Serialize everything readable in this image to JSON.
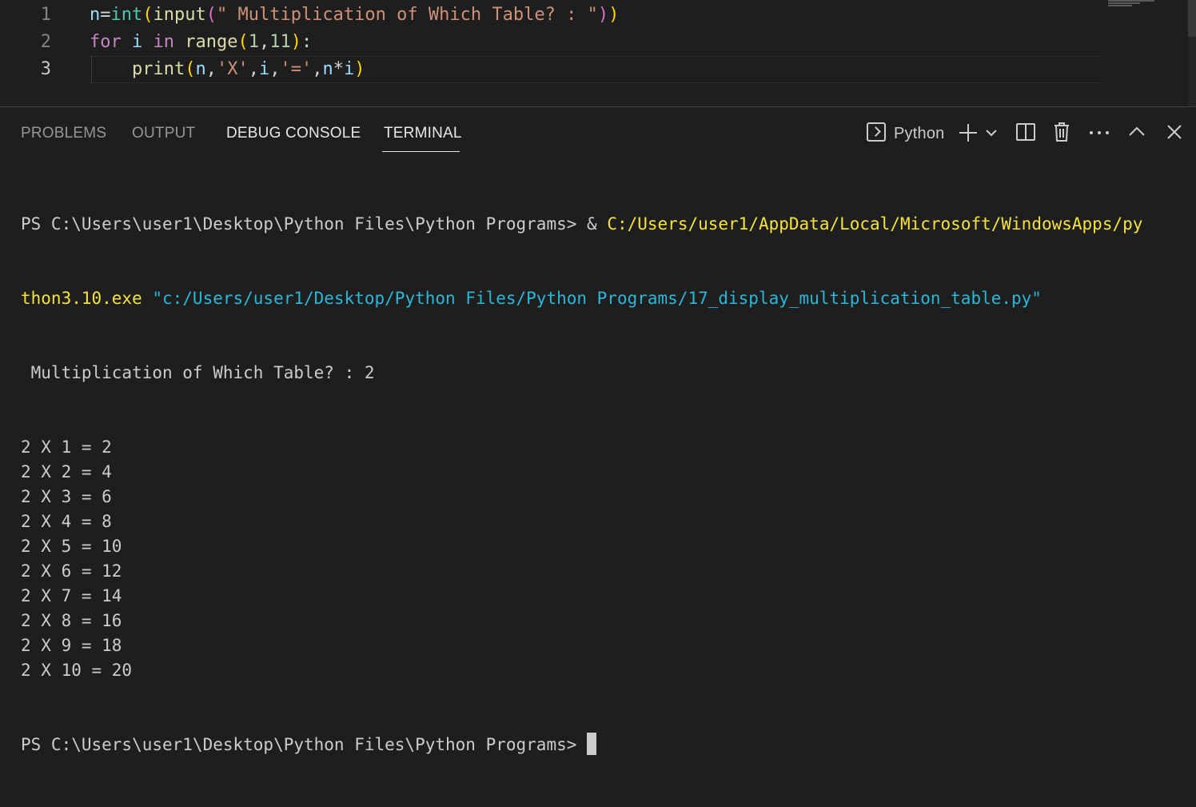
{
  "editor": {
    "lines": [
      {
        "number": "1",
        "tokens": [
          {
            "t": "n",
            "c": "t-var"
          },
          {
            "t": "=",
            "c": "t-op"
          },
          {
            "t": "int",
            "c": "t-fn"
          },
          {
            "t": "(",
            "c": "t-br1"
          },
          {
            "t": "input",
            "c": "t-call"
          },
          {
            "t": "(",
            "c": "t-br2"
          },
          {
            "t": "\" Multiplication of Which Table? : \"",
            "c": "t-str"
          },
          {
            "t": ")",
            "c": "t-br2"
          },
          {
            "t": ")",
            "c": "t-br1"
          }
        ]
      },
      {
        "number": "2",
        "tokens": [
          {
            "t": "for",
            "c": "t-kw"
          },
          {
            "t": " i ",
            "c": "t-var"
          },
          {
            "t": "in",
            "c": "t-kw"
          },
          {
            "t": " ",
            "c": "t-op"
          },
          {
            "t": "range",
            "c": "t-call"
          },
          {
            "t": "(",
            "c": "t-br1"
          },
          {
            "t": "1",
            "c": "t-num"
          },
          {
            "t": ",",
            "c": "t-op"
          },
          {
            "t": "11",
            "c": "t-num"
          },
          {
            "t": ")",
            "c": "t-br1"
          },
          {
            "t": ":",
            "c": "t-op"
          }
        ]
      },
      {
        "number": "3",
        "tokens": [
          {
            "t": "    ",
            "c": "t-op"
          },
          {
            "t": "print",
            "c": "t-call"
          },
          {
            "t": "(",
            "c": "t-br1"
          },
          {
            "t": "n",
            "c": "t-var"
          },
          {
            "t": ",",
            "c": "t-op"
          },
          {
            "t": "'X'",
            "c": "t-str"
          },
          {
            "t": ",",
            "c": "t-op"
          },
          {
            "t": "i",
            "c": "t-var"
          },
          {
            "t": ",",
            "c": "t-op"
          },
          {
            "t": "'='",
            "c": "t-str"
          },
          {
            "t": ",",
            "c": "t-op"
          },
          {
            "t": "n",
            "c": "t-var"
          },
          {
            "t": "*",
            "c": "t-op"
          },
          {
            "t": "i",
            "c": "t-var"
          },
          {
            "t": ")",
            "c": "t-br1"
          }
        ]
      }
    ]
  },
  "panel": {
    "tabs": [
      "PROBLEMS",
      "OUTPUT",
      "DEBUG CONSOLE",
      "TERMINAL"
    ],
    "active_tab": "TERMINAL",
    "terminal_name": "Python",
    "icons": [
      "terminal-icon",
      "add-icon",
      "chevron-down-icon",
      "split-icon",
      "trash-icon",
      "more-icon",
      "maximize-icon",
      "close-icon"
    ]
  },
  "terminal": {
    "cmd_prompt": "PS C:\\Users\\user1\\Desktop\\Python Files\\Python Programs> ",
    "cmd_amp": "& ",
    "cmd_exe_part1": "C:/Users/user1/AppData/Local/Microsoft/WindowsApps/py",
    "cmd_exe_part2": "thon3.10.exe",
    "cmd_arg": " \"c:/Users/user1/Desktop/Python Files/Python Programs/17_display_multiplication_table.py\"",
    "input_line": " Multiplication of Which Table? : 2",
    "output": [
      "2 X 1 = 2",
      "2 X 2 = 4",
      "2 X 3 = 6",
      "2 X 4 = 8",
      "2 X 5 = 10",
      "2 X 6 = 12",
      "2 X 7 = 14",
      "2 X 8 = 16",
      "2 X 9 = 18",
      "2 X 10 = 20"
    ],
    "final_prompt": "PS C:\\Users\\user1\\Desktop\\Python Files\\Python Programs> "
  }
}
